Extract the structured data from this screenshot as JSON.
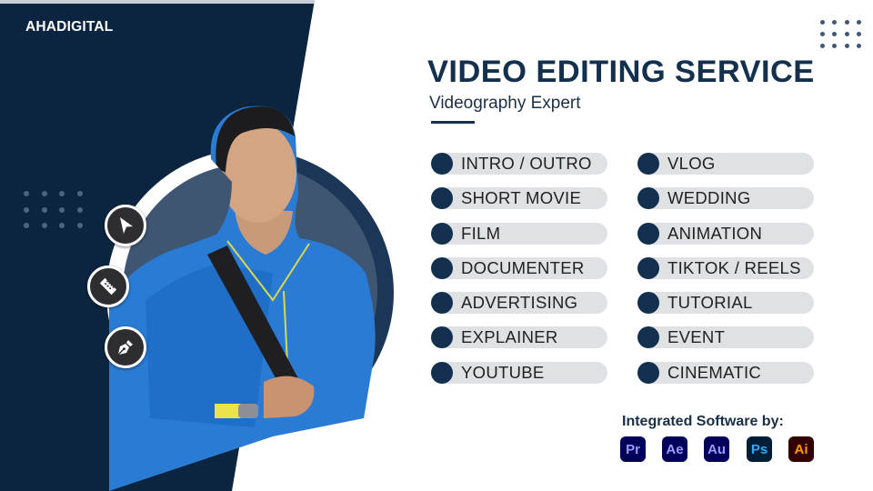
{
  "brand": {
    "name": "AHADIGITAL"
  },
  "header": {
    "title": "VIDEO EDITING SERVICE",
    "subtitle": "Videography Expert"
  },
  "colors": {
    "navy": "#0b2540",
    "accent": "#14304f",
    "pill_bg": "#dfe1e5"
  },
  "tools": [
    {
      "icon": "cursor-arrow-icon"
    },
    {
      "icon": "razor-blade-icon"
    },
    {
      "icon": "pen-tool-icon"
    }
  ],
  "services": {
    "left": [
      "INTRO / OUTRO",
      "SHORT MOVIE",
      "FILM",
      "DOCUMENTER",
      "ADVERTISING",
      "EXPLAINER",
      "YOUTUBE"
    ],
    "right": [
      "VLOG",
      "WEDDING",
      "ANIMATION",
      "TIKTOK / REELS",
      "TUTORIAL",
      "EVENT",
      "CINEMATIC"
    ]
  },
  "software": {
    "title": "Integrated Software by:",
    "apps": [
      {
        "abbr": "Pr",
        "name": "Premiere Pro",
        "bg": "#00005b",
        "fg": "#9999ff"
      },
      {
        "abbr": "Ae",
        "name": "After Effects",
        "bg": "#00005b",
        "fg": "#9999ff"
      },
      {
        "abbr": "Au",
        "name": "Audition",
        "bg": "#00005b",
        "fg": "#9999ff"
      },
      {
        "abbr": "Ps",
        "name": "Photoshop",
        "bg": "#001e36",
        "fg": "#31a8ff"
      },
      {
        "abbr": "Ai",
        "name": "Illustrator",
        "bg": "#330000",
        "fg": "#ff9a00"
      }
    ]
  }
}
